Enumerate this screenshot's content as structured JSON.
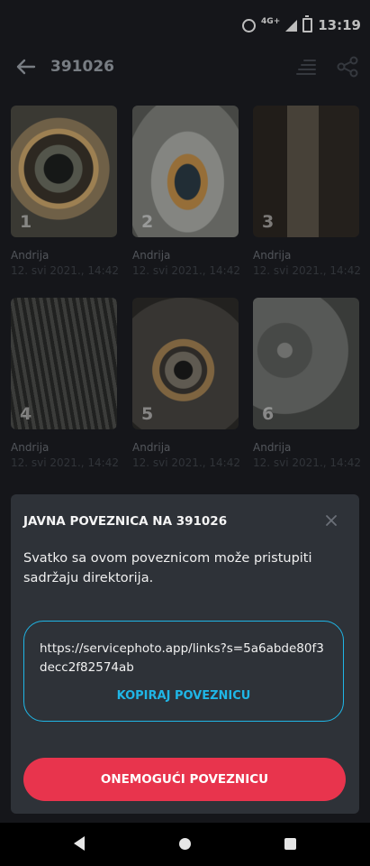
{
  "status_bar": {
    "network": "4G+",
    "time": "13:19",
    "icons": [
      "alarm-icon",
      "signal-icon",
      "battery-icon"
    ]
  },
  "app_bar": {
    "title": "391026",
    "icons": [
      "back-arrow-icon",
      "sort-icon",
      "share-icon"
    ]
  },
  "gallery": {
    "photos": [
      {
        "number": "1",
        "author": "Andrija",
        "date": "12. svi 2021., 14:42"
      },
      {
        "number": "2",
        "author": "Andrija",
        "date": "12. svi 2021., 14:42"
      },
      {
        "number": "3",
        "author": "Andrija",
        "date": "12. svi 2021., 14:42"
      },
      {
        "number": "4",
        "author": "Andrija",
        "date": "12. svi 2021., 14:42"
      },
      {
        "number": "5",
        "author": "Andrija",
        "date": "12. svi 2021., 14:42"
      },
      {
        "number": "6",
        "author": "Andrija",
        "date": "12. svi 2021., 14:42"
      }
    ]
  },
  "sheet": {
    "title": "JAVNA POVEZNICA NA 391026",
    "message": "Svatko sa ovom poveznicom može pristupiti sadržaju direktorija.",
    "link_url": "https://servicephoto.app/links?s=5a6abde80f3decc2f82574ab",
    "copy_label": "KOPIRAJ POVEZNICU",
    "disable_label": "ONEMOGUĆI POVEZNICU",
    "accent_color": "#1fb6e6",
    "danger_color": "#e8344d"
  },
  "nav_bar": {
    "icons": [
      "nav-back-icon",
      "nav-home-icon",
      "nav-recents-icon"
    ]
  }
}
